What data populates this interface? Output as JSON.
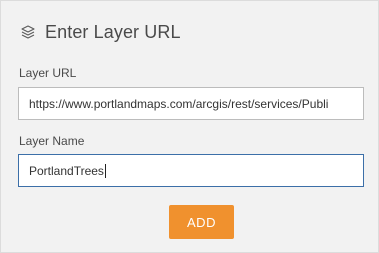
{
  "header": {
    "title": "Enter Layer URL",
    "icon": "layers-icon"
  },
  "fields": {
    "url": {
      "label": "Layer URL",
      "value": "https://www.portlandmaps.com/arcgis/rest/services/Publi"
    },
    "name": {
      "label": "Layer Name",
      "value": "PortlandTrees"
    }
  },
  "actions": {
    "add_label": "ADD"
  },
  "colors": {
    "accent_button": "#f0912e",
    "panel_background": "#f2f2f2",
    "focused_border": "#3c6fa8"
  }
}
